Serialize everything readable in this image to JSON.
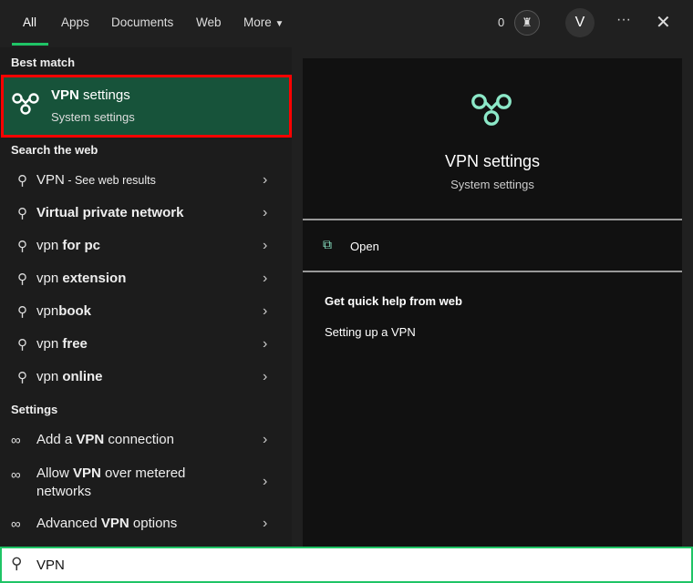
{
  "tabs": [
    {
      "label": "All"
    },
    {
      "label": "Apps"
    },
    {
      "label": "Documents"
    },
    {
      "label": "Web"
    },
    {
      "label": "More"
    }
  ],
  "header": {
    "points": "0",
    "avatar_letter": "V",
    "more_icon": "ellipsis-icon",
    "close_icon": "close-icon"
  },
  "sections": {
    "best": "Best match",
    "web": "Search the web",
    "settings": "Settings"
  },
  "best_match": {
    "title_bold": "VPN",
    "title_rest": " settings",
    "subtitle": "System settings"
  },
  "web_results": [
    {
      "plain": "VPN",
      "bold": "",
      "small": " - See web results"
    },
    {
      "plain": "",
      "bold": "Virtual private network",
      "small": ""
    },
    {
      "plain": "vpn ",
      "bold": "for pc",
      "small": ""
    },
    {
      "plain": "vpn ",
      "bold": "extension",
      "small": ""
    },
    {
      "plain": "vpn",
      "bold": "book",
      "small": ""
    },
    {
      "plain": "vpn ",
      "bold": "free",
      "small": ""
    },
    {
      "plain": "vpn ",
      "bold": "online",
      "small": ""
    }
  ],
  "settings_results": [
    {
      "pre": "Add a ",
      "bold": "VPN",
      "post": " connection"
    },
    {
      "pre": "Allow ",
      "bold": "VPN",
      "post": " over metered networks"
    },
    {
      "pre": "Advanced ",
      "bold": "VPN",
      "post": " options"
    }
  ],
  "detail": {
    "title": "VPN settings",
    "subtitle": "System settings",
    "open": "Open",
    "help_heading": "Get quick help from web",
    "help_link": "Setting up a VPN"
  },
  "search": {
    "value": "VPN"
  },
  "colors": {
    "accent": "#1fc466",
    "selected": "#17533a",
    "icon": "#8ce8c8"
  }
}
